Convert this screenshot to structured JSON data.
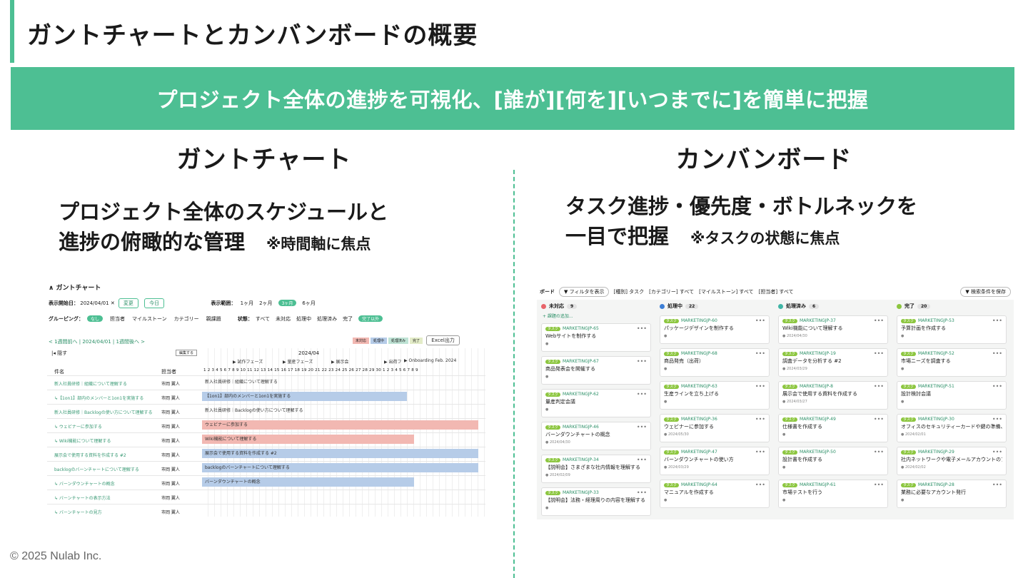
{
  "title": "ガントチャートとカンバンボードの概要",
  "banner": "プロジェクト全体の進捗を可視化、[誰が][何を][いつまでに]を簡単に把握",
  "left": {
    "heading": "ガントチャート",
    "lead1": "プロジェクト全体のスケジュールと",
    "lead2": "進捗の俯瞰的な管理",
    "note": "※時間軸に焦点"
  },
  "right": {
    "heading": "カンバンボード",
    "lead1": "タスク進捗・優先度・ボトルネックを",
    "lead2": "一目で把握",
    "note": "※タスクの状態に焦点"
  },
  "footer": "© 2025 Nulab Inc.",
  "gantt": {
    "header": "ガントチャート",
    "start_label": "表示開始日：",
    "start_value": "2024/04/01",
    "change": "変更",
    "today": "今日",
    "range_label": "表示範囲：",
    "ranges": [
      "1ヶ月",
      "2ヶ月",
      "3ヶ月",
      "6ヶ月"
    ],
    "grouping_label": "グルーピング：",
    "grouping": [
      "なし",
      "担当者",
      "マイルストーン",
      "カテゴリー",
      "親課題"
    ],
    "status_label": "状態：",
    "statuses": [
      "すべて",
      "未対応",
      "処理中",
      "処理済み",
      "完了",
      "完了以外"
    ],
    "nav": "< 1週間前へ | 2024/04/01 | 1週間後へ >",
    "legend": [
      "未対応",
      "処理中",
      "処理済み",
      "完了"
    ],
    "excel": "Excel出力",
    "hide": "隠す",
    "edit": "編集する",
    "month": "2024/04",
    "col_task": "件名",
    "col_owner": "担当者",
    "milestones": [
      "試作フェーズ",
      "量産フェーズ",
      "展示会",
      "出荷フ",
      "Onboarding Feb. 2024"
    ],
    "rows": [
      {
        "task": "新入社員研修｜組織について理解する",
        "owner": "市岡 翼人",
        "bar": "新入社員研修｜組織について理解する"
      },
      {
        "task": "↳【1on1】部内のメンバーと1on1を実施する",
        "owner": "市岡 翼人",
        "bar": "【1on1】部内のメンバーと1on1を実施する"
      },
      {
        "task": "新入社員研修｜Backlogの使い方について理解する",
        "owner": "市岡 翼人",
        "bar": "新入社員研修｜Backlogの使い方について理解する"
      },
      {
        "task": "↳ ウェビナーに参加する",
        "owner": "市岡 翼人",
        "bar": "ウェビナーに参加する"
      },
      {
        "task": "↳ Wiki機能について理解する",
        "owner": "市岡 翼人",
        "bar": "Wiki機能について理解する"
      },
      {
        "task": "展示会で使用する資料を作成する #2",
        "owner": "市岡 翼人",
        "bar": "展示会で使用する資料を作成する #2"
      },
      {
        "task": "backlogのバーンチャートについて理解する",
        "owner": "市岡 翼人",
        "bar": "backlogのバーンチャートについて理解する"
      },
      {
        "task": "↳ バーンダウンチャートの概念",
        "owner": "市岡 翼人",
        "bar": "バーンダウンチャートの概念"
      },
      {
        "task": "↳ バーンチャートの表示方法",
        "owner": "市岡 翼人",
        "bar": ""
      },
      {
        "task": "↳ バーンチャートの見方",
        "owner": "市岡 翼人",
        "bar": ""
      }
    ]
  },
  "kanban": {
    "board": "ボード",
    "filter": "フィルタを表示",
    "toolbar": "[種別] タスク　[カテゴリー] すべて　[マイルストーン] すべて　[担当者] すべて",
    "save": "検索条件を保存",
    "add": "+ 課題の追加...",
    "columns": [
      {
        "name": "未対応",
        "count": "9",
        "color": "#e8646a",
        "cards": [
          {
            "key": "MARKETINGJP-65",
            "title": "Webサイトを制作する",
            "date": ""
          },
          {
            "key": "MARKETINGJP-67",
            "title": "商品発表会を開催する",
            "date": ""
          },
          {
            "key": "MARKETINGJP-62",
            "title": "量産判定会議",
            "date": ""
          },
          {
            "key": "MARKETINGJP-46",
            "title": "バーンダウンチャートの概念",
            "date": "2024/04/30"
          },
          {
            "key": "MARKETINGJP-34",
            "title": "【説明会】さまざまな社内情報を理解する",
            "date": "2024/02/09"
          },
          {
            "key": "MARKETINGJP-33",
            "title": "【説明会】法務・経理周りの内容を理解する",
            "date": ""
          }
        ]
      },
      {
        "name": "処理中",
        "count": "22",
        "color": "#3d7fd6",
        "cards": [
          {
            "key": "MARKETINGJP-60",
            "title": "パッケージデザインを制作する",
            "date": ""
          },
          {
            "key": "MARKETINGJP-68",
            "title": "商品発売（出荷）",
            "date": ""
          },
          {
            "key": "MARKETINGJP-63",
            "title": "生産ラインを立ち上げる",
            "date": ""
          },
          {
            "key": "MARKETINGJP-36",
            "title": "ウェビナーに参加する",
            "date": "2024/05/30"
          },
          {
            "key": "MARKETINGJP-47",
            "title": "バーンダウンチャートの使い方",
            "date": "2024/03/29"
          },
          {
            "key": "MARKETINGJP-64",
            "title": "マニュアルを作成する",
            "date": ""
          }
        ]
      },
      {
        "name": "処理済み",
        "count": "6",
        "color": "#3fb5a5",
        "cards": [
          {
            "key": "MARKETINGJP-37",
            "title": "Wiki機能について理解する",
            "date": "2024/04/30"
          },
          {
            "key": "MARKETINGJP-19",
            "title": "調査データを分析する #2",
            "date": "2024/03/29"
          },
          {
            "key": "MARKETINGJP-8",
            "title": "展示会で使用する資料を作成する",
            "date": "2024/03/27"
          },
          {
            "key": "MARKETINGJP-49",
            "title": "仕様書を作成する",
            "date": ""
          },
          {
            "key": "MARKETINGJP-50",
            "title": "設計書を作成する",
            "date": ""
          },
          {
            "key": "MARKETINGJP-61",
            "title": "市場テストを行う",
            "date": ""
          }
        ]
      },
      {
        "name": "完了",
        "count": "20",
        "color": "#8cc63f",
        "cards": [
          {
            "key": "MARKETINGJP-53",
            "title": "予算計画を作成する",
            "date": ""
          },
          {
            "key": "MARKETINGJP-52",
            "title": "市場ニーズを調査する",
            "date": ""
          },
          {
            "key": "MARKETINGJP-51",
            "title": "設計検討会議",
            "date": ""
          },
          {
            "key": "MARKETINGJP-30",
            "title": "オフィスのセキュリティーカードや鍵の準備、入退出方法の確認",
            "date": "2024/02/01"
          },
          {
            "key": "MARKETINGJP-29",
            "title": "社内ネットワークや電子メールアカウントのアクセス権を設定",
            "date": "2024/02/02"
          },
          {
            "key": "MARKETINGJP-28",
            "title": "業務に必要なアカウント発行",
            "date": ""
          }
        ]
      }
    ]
  }
}
